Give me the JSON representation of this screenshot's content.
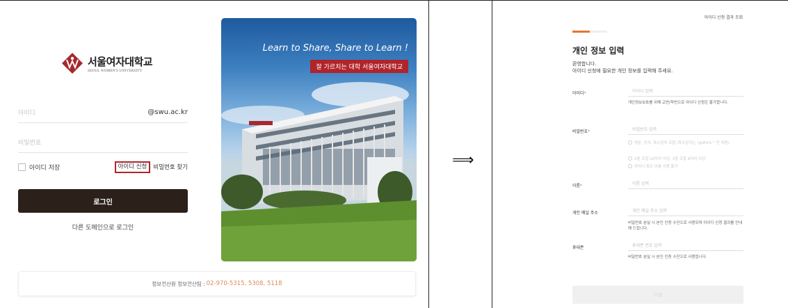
{
  "login": {
    "logo_name": "서울여자대학교",
    "logo_sub": "SEOUL WOMEN'S UNIVERSITY",
    "id_placeholder": "아이디",
    "id_suffix": "@swu.ac.kr",
    "pw_placeholder": "비밀번호",
    "save_id_label": "아이디 저장",
    "apply_id_label": "아이디 신청",
    "find_pw_label": "비밀번호 찾기",
    "login_button": "로그인",
    "other_domain_link": "다른 도메인으로 로그인",
    "hero_title": "Learn to Share, Share to Learn !",
    "hero_subtitle": "잘 가르치는 대학 서울여자대학교",
    "footer_team": "정보전산원 정보전산팀 :",
    "footer_phone": "02-970-5315, 5308, 5118"
  },
  "arrow": "⟹",
  "apply": {
    "top_link": "아이디 신청 결과 조회",
    "progress": 0.5,
    "title": "개인 정보 입력",
    "welcome_line1": "환영합니다.",
    "welcome_line2": "아이디 신청에 필요한 개인 정보를 입력해 주세요.",
    "id_label": "아이디",
    "id_placeholder": "아이디 입력",
    "id_hint": "개인정보보호를 위해 교번/학번으로 아이디 신청은 불가합니다.",
    "pw_label": "비밀번호",
    "pw_placeholder": "비밀번호 입력",
    "pw_rules": [
      "영문, 숫자, 특수문자 조합 (특수문자는 !@#$%^ 만 허용)",
      "2종 조합 10자리 이상, 3종 조합 8자리 이상",
      "아이디 혹은 이름 사용 불가"
    ],
    "name_label": "이름",
    "name_placeholder": "이름 입력",
    "email_label": "개인 메일 주소",
    "email_placeholder": "개인 메일 주소 입력",
    "email_hint": "비밀번호 분실 시 본인 인증 수단으로 사용되며 아이디 신청 결과를 안내해 드립니다.",
    "phone_label": "휴대폰",
    "phone_placeholder": "휴대폰 번호 입력",
    "phone_hint": "비밀번호 분실 시 본인 인증 수단으로 사용됩니다.",
    "required_mark": "*",
    "submit_label": "다음"
  }
}
